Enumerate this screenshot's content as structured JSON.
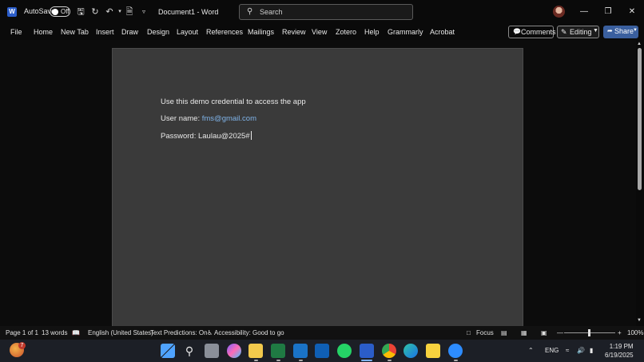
{
  "window": {
    "autosave_label": "AutoSave",
    "autosave_state": "Off",
    "doc_title": "Document1  -  Word",
    "search_placeholder": "Search"
  },
  "ribbon": {
    "tabs": [
      "File",
      "Home",
      "New Tab",
      "Insert",
      "Draw",
      "Design",
      "Layout",
      "References",
      "Mailings",
      "Review",
      "View",
      "Zotero",
      "Help",
      "Grammarly",
      "Acrobat"
    ],
    "comments_label": "Comments",
    "editing_label": "Editing",
    "share_label": "Share"
  },
  "document": {
    "line1": "Use this demo credential to access the app",
    "username_label": "User name: ",
    "username_value": "fms@gmail.com",
    "password_line": "Password: Laulau@2025#"
  },
  "statusbar": {
    "page": "Page 1 of 1",
    "words": "13 words",
    "language": "English (United States)",
    "text_predictions": "Text Predictions: On",
    "accessibility": "Accessibility: Good to go",
    "focus": "Focus",
    "zoom": "100%"
  },
  "taskbar": {
    "language": "ENG",
    "time": "1:19 PM",
    "date": "6/19/2025",
    "notification_count": "7"
  },
  "colors": {
    "word_blue": "#2b5dc9",
    "share_blue": "#3a5f9e",
    "link": "#7fb3e8",
    "page_bg": "#3a3a3a"
  }
}
